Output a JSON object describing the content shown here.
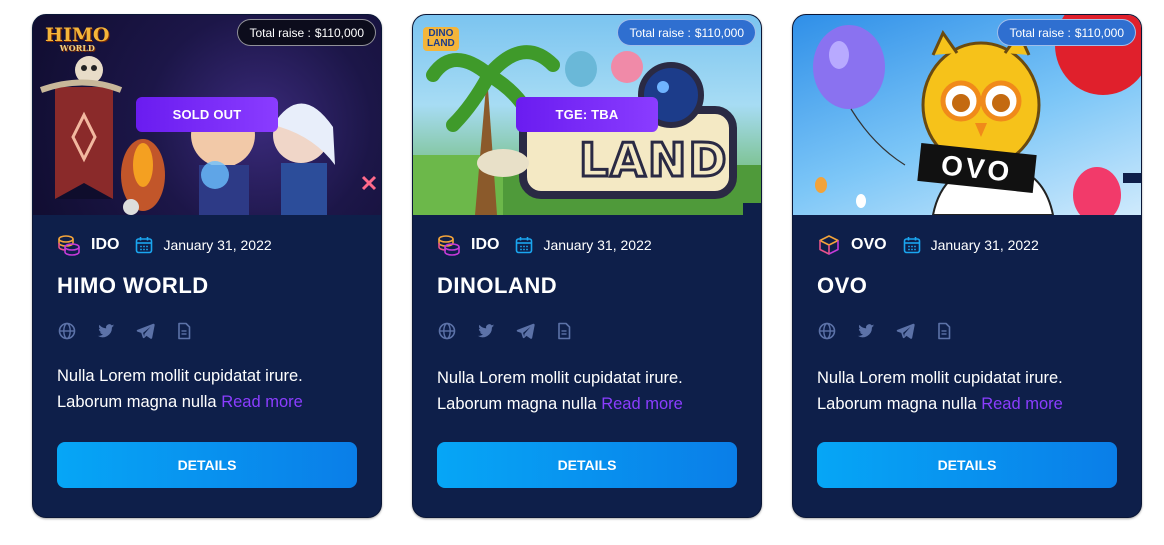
{
  "cards": [
    {
      "logo_text": "HIMO",
      "logo_sub": "WORLD",
      "raise_label": "Total raise :",
      "raise_value": "$110,000",
      "status_label": "SOLD OUT",
      "type_label": "IDO",
      "type_icon": "coin-stack-icon",
      "date": "January 31, 2022",
      "title": "HIMO WORLD",
      "description": "Nulla Lorem mollit cupidatat irure. Laborum magna nulla",
      "read_more": "Read more",
      "button_label": "DETAILS"
    },
    {
      "logo_text": "DINO",
      "logo_sub": "LAND",
      "art_text": "LAND",
      "raise_label": "Total raise :",
      "raise_value": "$110,000",
      "status_label": "TGE: TBA",
      "type_label": "IDO",
      "type_icon": "coin-stack-icon",
      "date": "January 31, 2022",
      "title": "DINOLAND",
      "description": "Nulla Lorem mollit cupidatat irure. Laborum magna nulla",
      "read_more": "Read more",
      "button_label": "DETAILS"
    },
    {
      "art_text": "OVO",
      "raise_label": "Total raise :",
      "raise_value": "$110,000",
      "type_label": "OVO",
      "type_icon": "box-icon",
      "date": "January 31, 2022",
      "title": "OVO",
      "description": "Nulla Lorem mollit cupidatat irure. Laborum magna nulla",
      "read_more": "Read more",
      "button_label": "DETAILS"
    }
  ],
  "colors": {
    "card_bg": "#0e1f4a",
    "accent_purple": "#8b3dff",
    "button_blue": "#0a8ef0",
    "icon_muted": "#5c72a8",
    "calendar_cyan": "#1aa6f0"
  }
}
